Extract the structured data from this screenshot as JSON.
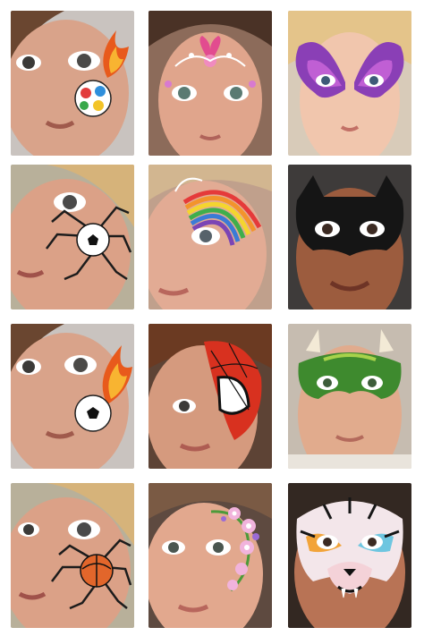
{
  "gallery": {
    "tiles": [
      {
        "design": "flame-soccer-ball",
        "skin": "#d9a38a",
        "bg": "#c9c3bf"
      },
      {
        "design": "pink-flower-crown",
        "skin": "#e0a58c",
        "bg": "#8c6b5a"
      },
      {
        "design": "purple-butterfly",
        "skin": "#f1c6ad",
        "bg": "#d8cbb9"
      },
      {
        "design": "spider-soccer-ball",
        "skin": "#dba187",
        "bg": "#b8b09a"
      },
      {
        "design": "rainbow-swirl",
        "skin": "#e2ab94",
        "bg": "#c0a08c"
      },
      {
        "design": "batman-mask",
        "skin": "#9c5c3e",
        "bg": "#3e3b3a"
      },
      {
        "design": "flame-soccer-ball",
        "skin": "#d9a38a",
        "bg": "#c9c3bf"
      },
      {
        "design": "spiderman-half-mask",
        "skin": "#d59a7e",
        "bg": "#5d4335"
      },
      {
        "design": "green-dragon",
        "skin": "#e1ab8d",
        "bg": "#c6bcb0"
      },
      {
        "design": "orange-spider-ball",
        "skin": "#dba187",
        "bg": "#b8b09a"
      },
      {
        "design": "flower-vine",
        "skin": "#e2a88e",
        "bg": "#5e4a40"
      },
      {
        "design": "rainbow-tiger",
        "skin": "#b87355",
        "bg": "#332822"
      }
    ]
  }
}
